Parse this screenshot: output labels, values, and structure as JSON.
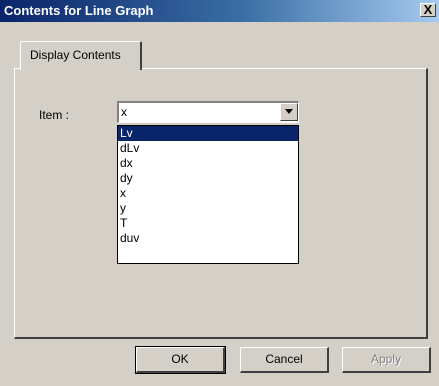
{
  "window": {
    "title": "Contents for Line Graph",
    "close_label": "X"
  },
  "tabs": [
    {
      "label": "Display Contents",
      "active": true
    }
  ],
  "item_field": {
    "label": "Item :",
    "value": "x"
  },
  "dropdown": {
    "options": [
      "Lv",
      "dLv",
      "dx",
      "dy",
      "x",
      "y",
      "T",
      "duv"
    ],
    "highlighted": "Lv"
  },
  "buttons": {
    "ok": "OK",
    "cancel": "Cancel",
    "apply": "Apply"
  },
  "colors": {
    "titlebar": "#0a246a",
    "selection": "#0a246a",
    "face": "#d4d0c8"
  }
}
